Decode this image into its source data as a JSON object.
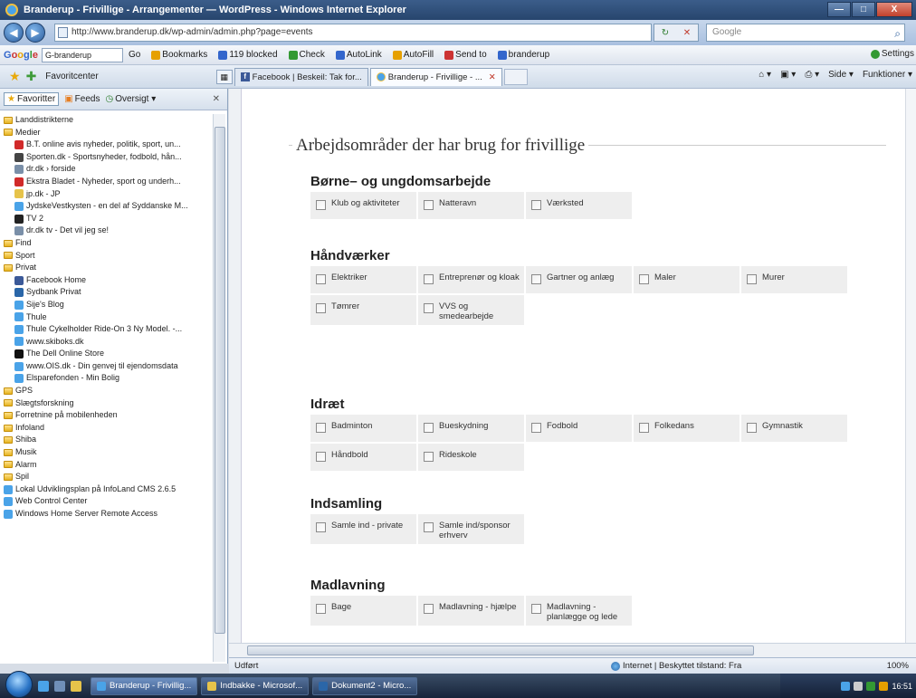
{
  "window": {
    "title": "Branderup - Frivillige - Arrangementer — WordPress - Windows Internet Explorer",
    "min": "—",
    "max": "□",
    "close": "X"
  },
  "address": {
    "url": "http://www.branderup.dk/wp-admin/admin.php?page=events",
    "search_placeholder": "Google"
  },
  "gtoolbar": {
    "search_value": "G-branderup",
    "go": "Go",
    "items": [
      {
        "label": "Bookmarks",
        "color": "#e6a000"
      },
      {
        "label": "119 blocked",
        "color": "#3366cc"
      },
      {
        "label": "Check",
        "color": "#339933"
      },
      {
        "label": "AutoLink",
        "color": "#3366cc"
      },
      {
        "label": "AutoFill",
        "color": "#e6a000"
      },
      {
        "label": "Send to",
        "color": "#cc3333"
      },
      {
        "label": "branderup",
        "color": "#3366cc"
      }
    ],
    "settings": "Settings"
  },
  "favbar": {
    "label": "Favoritcenter",
    "tabs": [
      {
        "label": "Facebook | Beskeil: Tak for...",
        "type": "fb"
      },
      {
        "label": "Branderup - Frivillige - ...",
        "type": "ie",
        "active": true
      }
    ],
    "commands": [
      "Side ▾",
      "Funktioner ▾"
    ]
  },
  "leftpanel": {
    "tabs": [
      "Favoritter",
      "Feeds",
      "Oversigt ▾"
    ],
    "items": [
      {
        "label": "Landdistrikterne",
        "kind": "folder",
        "indent": false
      },
      {
        "label": "Medier",
        "kind": "folder",
        "indent": false
      },
      {
        "label": "B.T. online avis nyheder, politik, sport, un...",
        "kind": "page",
        "color": "#d12a2a",
        "indent": true
      },
      {
        "label": "Sporten.dk - Sportsnyheder, fodbold, hån...",
        "kind": "page",
        "color": "#444",
        "indent": true
      },
      {
        "label": "dr.dk › forside",
        "kind": "page",
        "color": "#7a8fa8",
        "indent": true
      },
      {
        "label": "Ekstra Bladet - Nyheder, sport og underh...",
        "kind": "page",
        "color": "#d12a2a",
        "indent": true
      },
      {
        "label": "jp.dk - JP",
        "kind": "page",
        "color": "#e6c34a",
        "indent": true
      },
      {
        "label": "JydskeVestkysten - en del af Syddanske M...",
        "kind": "page",
        "color": "#4aa3e8",
        "indent": true
      },
      {
        "label": "TV 2",
        "kind": "page",
        "color": "#222",
        "indent": true
      },
      {
        "label": "dr.dk tv - Det vil jeg se!",
        "kind": "page",
        "color": "#7a8fa8",
        "indent": true
      },
      {
        "label": "Find",
        "kind": "folder",
        "indent": false
      },
      {
        "label": "Sport",
        "kind": "folder",
        "indent": false
      },
      {
        "label": "Privat",
        "kind": "folder",
        "indent": false
      },
      {
        "label": "Facebook Home",
        "kind": "page",
        "color": "#3b5998",
        "indent": true
      },
      {
        "label": "Sydbank Privat",
        "kind": "page",
        "color": "#2a66a8",
        "indent": true
      },
      {
        "label": "Sije's Blog",
        "kind": "page",
        "color": "#4aa3e8",
        "indent": true
      },
      {
        "label": "Thule",
        "kind": "page",
        "color": "#4aa3e8",
        "indent": true
      },
      {
        "label": "Thule Cykelholder Ride-On 3 Ny Model. -...",
        "kind": "page",
        "color": "#4aa3e8",
        "indent": true
      },
      {
        "label": "www.skiboks.dk",
        "kind": "page",
        "color": "#4aa3e8",
        "indent": true
      },
      {
        "label": "The Dell Online Store",
        "kind": "page",
        "color": "#111",
        "indent": true
      },
      {
        "label": "www.OIS.dk - Din genvej til ejendomsdata",
        "kind": "page",
        "color": "#4aa3e8",
        "indent": true
      },
      {
        "label": "Elsparefonden - Min Bolig",
        "kind": "page",
        "color": "#4aa3e8",
        "indent": true
      },
      {
        "label": "GPS",
        "kind": "folder",
        "indent": false
      },
      {
        "label": "Slægtsforskning",
        "kind": "folder",
        "indent": false
      },
      {
        "label": "Forretnine på mobilenheden",
        "kind": "folder",
        "indent": false
      },
      {
        "label": "Infoland",
        "kind": "folder",
        "indent": false
      },
      {
        "label": "Shiba",
        "kind": "folder",
        "indent": false
      },
      {
        "label": "Musik",
        "kind": "folder",
        "indent": false
      },
      {
        "label": "Alarm",
        "kind": "folder",
        "indent": false
      },
      {
        "label": "Spil",
        "kind": "folder",
        "indent": false
      },
      {
        "label": "Lokal Udviklingsplan på InfoLand CMS 2.6.5",
        "kind": "page",
        "color": "#4aa3e8",
        "indent": false
      },
      {
        "label": "Web Control Center",
        "kind": "page",
        "color": "#4aa3e8",
        "indent": false
      },
      {
        "label": "Windows Home Server Remote Access",
        "kind": "page",
        "color": "#4aa3e8",
        "indent": false
      }
    ]
  },
  "content": {
    "legend": "Arbejdsområder der har brug for frivillige",
    "sections": [
      {
        "title": "Børne– og ungdomsarbejde",
        "items": [
          "Klub og aktiviteter",
          "Natteravn",
          "Værksted"
        ]
      },
      {
        "title": "Håndværker",
        "items": [
          "Elektriker",
          "Entreprenør og kloak",
          "Gartner og anlæg",
          "Maler",
          "Murer",
          "Tømrer",
          "VVS og smedearbejde"
        ]
      },
      {
        "title": "Idræt",
        "items": [
          "Badminton",
          "Bueskydning",
          "Fodbold",
          "Folkedans",
          "Gymnastik",
          "Håndbold",
          "Rideskole"
        ]
      },
      {
        "title": "Indsamling",
        "items": [
          "Samle ind - private",
          "Samle ind/sponsor erhverv"
        ]
      },
      {
        "title": "Madlavning",
        "items": [
          "Bage",
          "Madlavning - hjælpe",
          "Madlavning - planlægge og lede"
        ]
      }
    ]
  },
  "status": {
    "left": "Udført",
    "zone": "Internet | Beskyttet tilstand: Fra",
    "zoom": "100%"
  },
  "taskbar": {
    "tasks": [
      {
        "label": "Branderup - Frivillig...",
        "color": "#4aa3e8",
        "active": true
      },
      {
        "label": "Indbakke - Microsof...",
        "color": "#e6c34a",
        "active": false
      },
      {
        "label": "Dokument2 - Micro...",
        "color": "#2a66a8",
        "active": false
      }
    ],
    "clock": "16:51"
  }
}
